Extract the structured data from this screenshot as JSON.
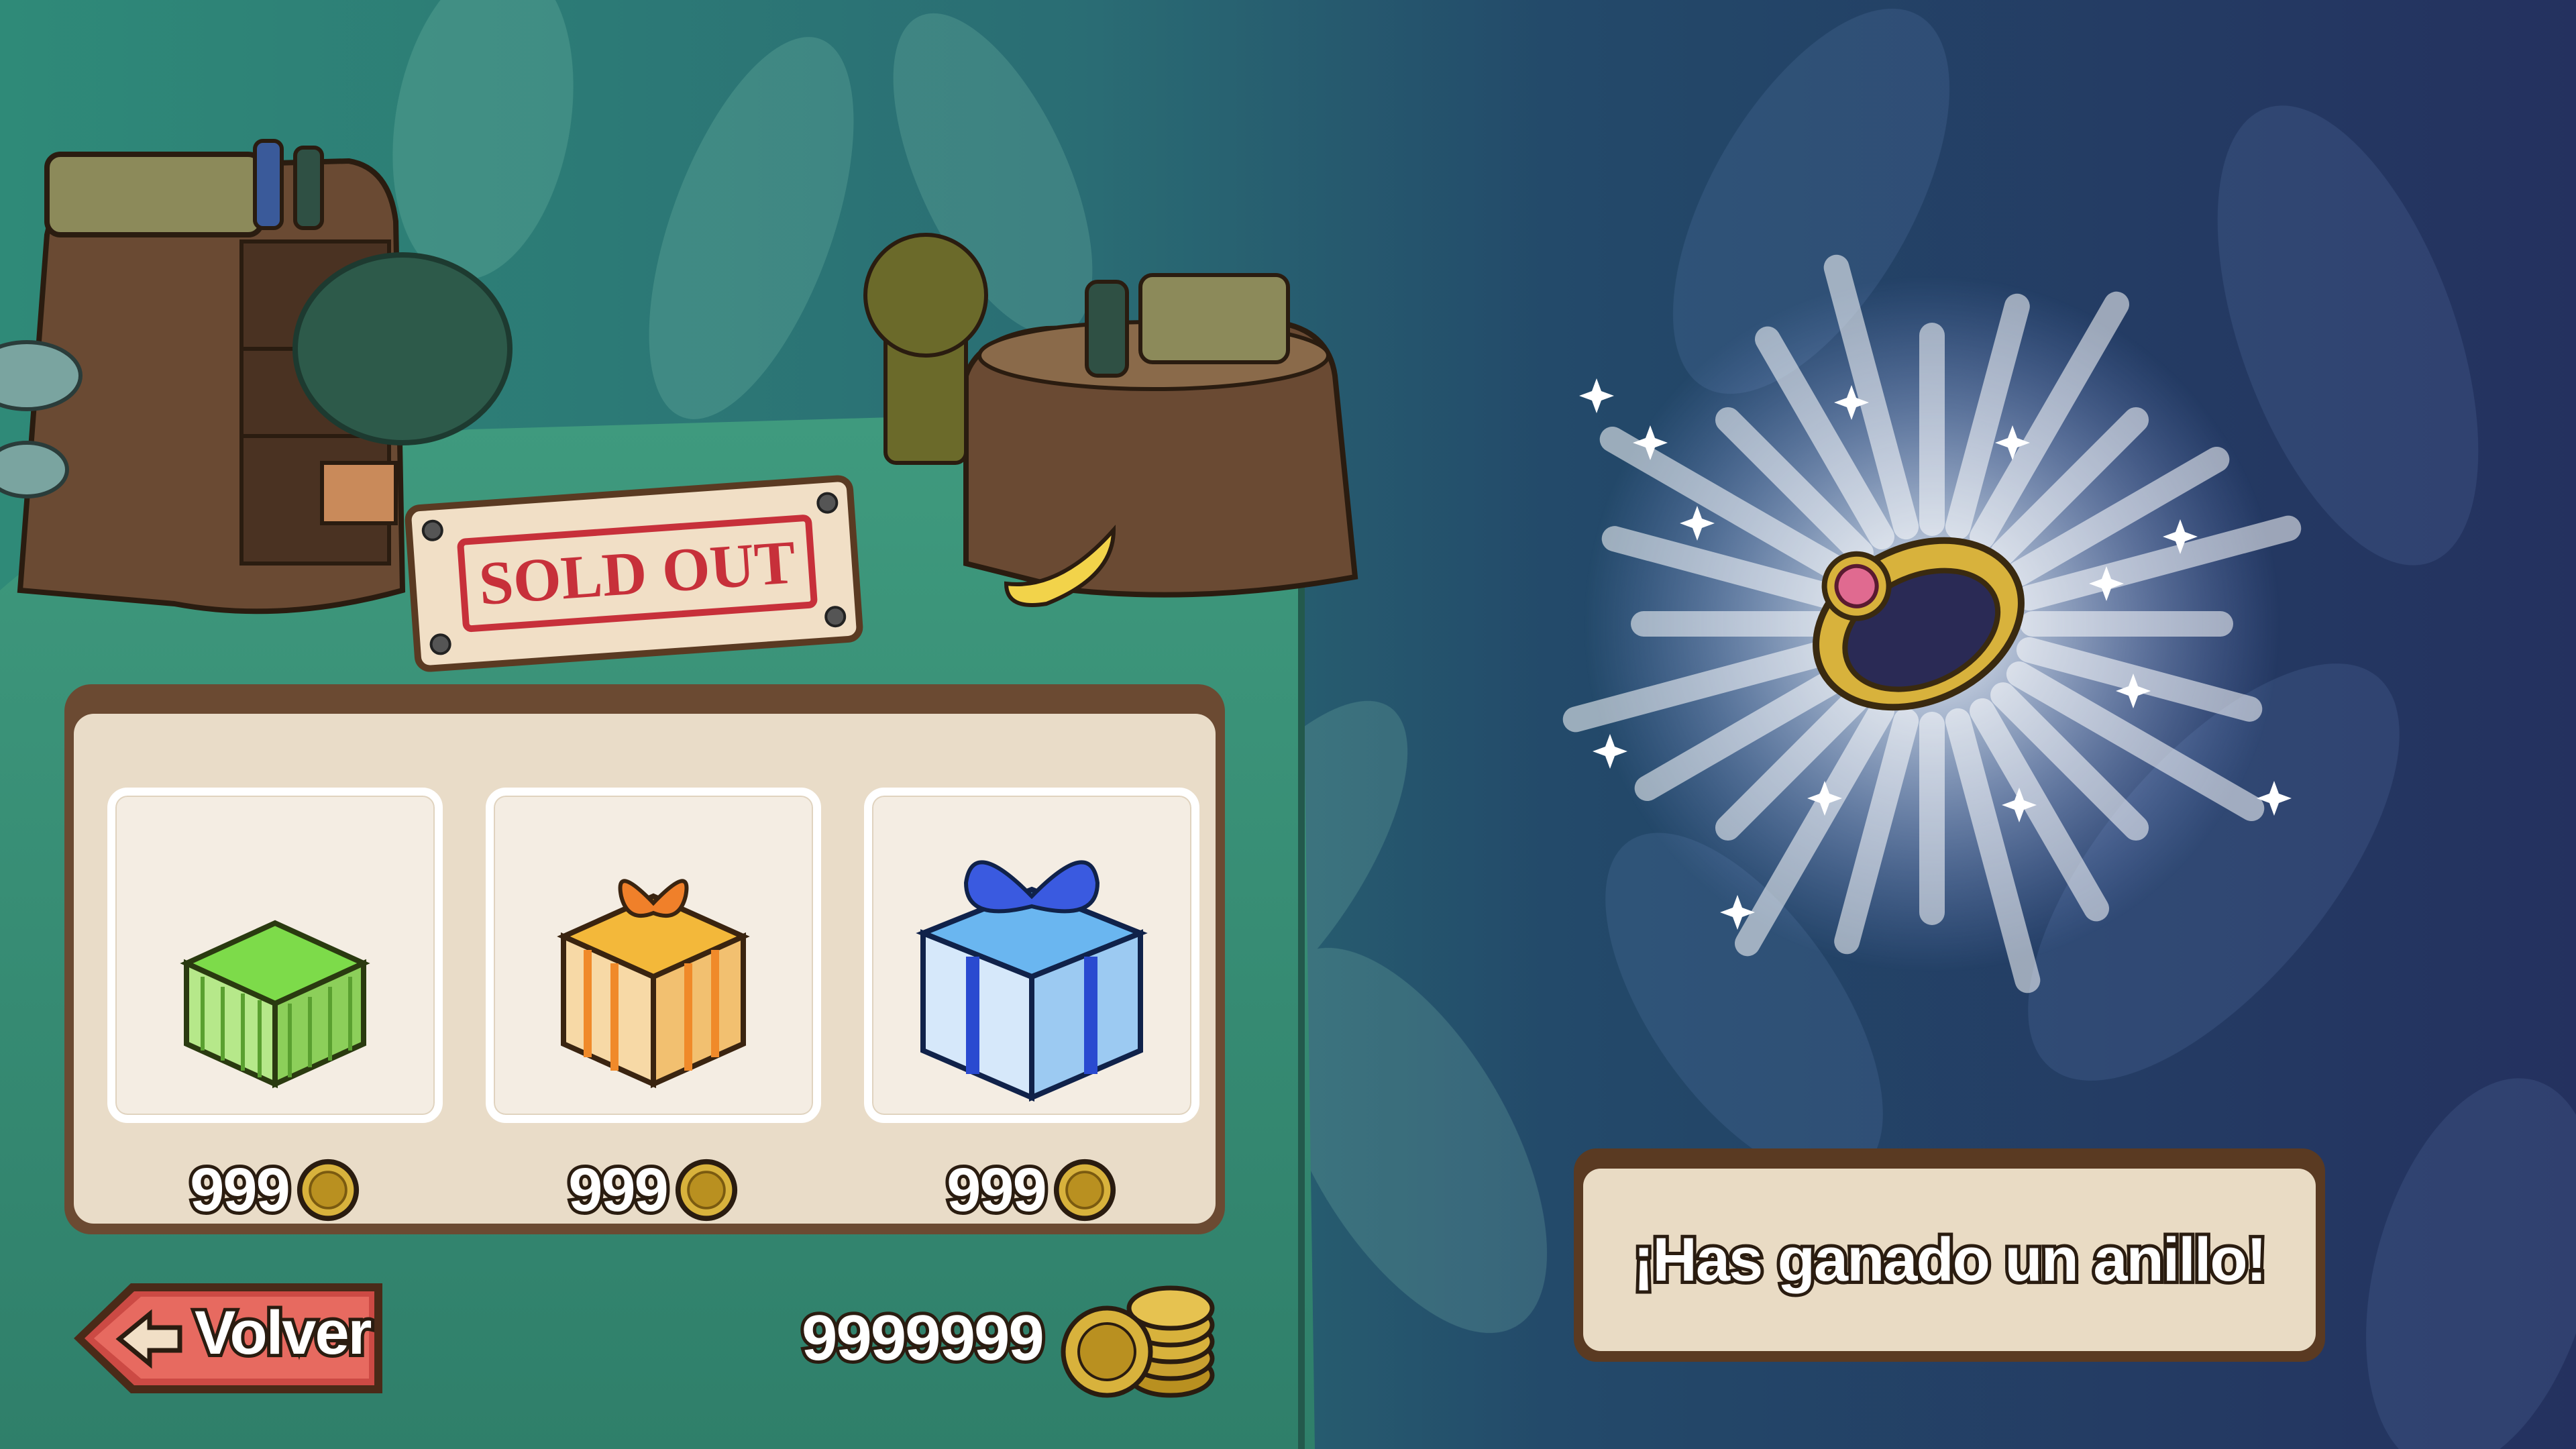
{
  "shop": {
    "sign_text": "SOLD OUT",
    "items": [
      {
        "name": "green-gift-box",
        "price": "999"
      },
      {
        "name": "orange-gift-box",
        "price": "999"
      },
      {
        "name": "blue-gift-box",
        "price": "999"
      }
    ]
  },
  "footer": {
    "back_label": "Volver",
    "currency_amount": "9999999"
  },
  "reward": {
    "message": "¡Has ganado un anillo!"
  },
  "icons": {
    "coin": "coin-icon",
    "coin_stack": "coin-stack-icon",
    "ring": "ring-icon",
    "back_arrow": "arrow-left-icon"
  },
  "colors": {
    "jungle_green": "#2f8a78",
    "night_blue": "#24315f",
    "panel_brown": "#6b4a32",
    "panel_cream": "#e9dcc8",
    "stamp_red": "#c7303a",
    "gold": "#d8b23c"
  }
}
